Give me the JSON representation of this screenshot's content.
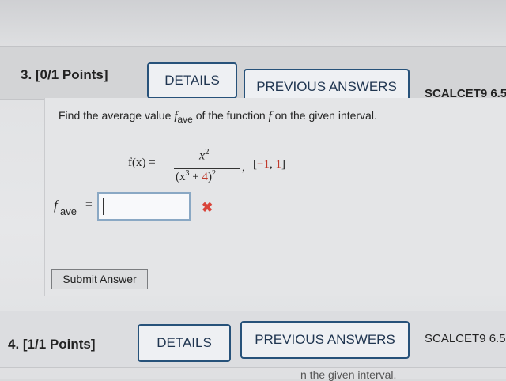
{
  "question3": {
    "number_label": "3. [0/1 Points]",
    "details_label": "DETAILS",
    "previous_answers_label": "PREVIOUS ANSWERS",
    "source_label": "SCALCET9 6.5"
  },
  "problem": {
    "prompt_start": "Find the average value ",
    "prompt_f": "f",
    "prompt_sub": "ave",
    "prompt_mid": " of the function ",
    "prompt_func": "f",
    "prompt_end": " on the given interval.",
    "func_lhs": "f(x)  =",
    "numerator_base": "x",
    "numerator_exp": "2",
    "denominator_open": "(x",
    "denominator_inner_exp": "3",
    "denominator_plus": " + ",
    "denominator_const": "4",
    "denominator_close": ")",
    "denominator_outer_exp": "2",
    "comma": ",",
    "interval_open": "[",
    "interval_lower": "−1",
    "interval_sep": ", ",
    "interval_upper": "1",
    "interval_close": "]"
  },
  "answer": {
    "label_f": "f",
    "label_sub": "ave",
    "equals": "=",
    "input_value": "",
    "status_icon": "incorrect-x-icon",
    "status_glyph": "✖",
    "status_color": "#d9453b"
  },
  "submit_label": "Submit Answer",
  "question4": {
    "number_label": "4. [1/1 Points]",
    "details_label": "DETAILS",
    "previous_answers_label": "PREVIOUS ANSWERS",
    "source_label": "SCALCET9 6.5"
  },
  "next_prompt_fragment": "n the given interval.",
  "colors": {
    "button_border": "#27527a",
    "error": "#d9453b",
    "highlight_number": "#c0392b"
  }
}
